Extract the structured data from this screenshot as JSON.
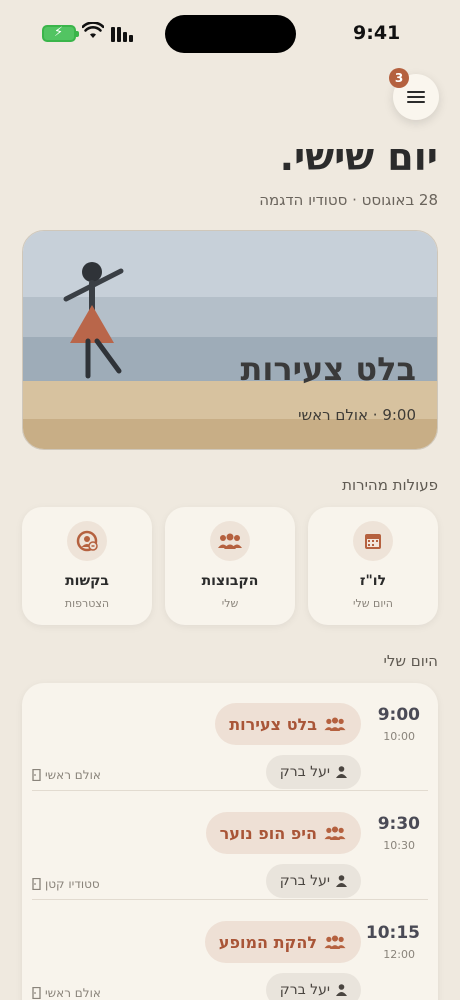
{
  "status": {
    "time": "9:41"
  },
  "menu": {
    "badge_count": "3"
  },
  "header": {
    "title": "יום שישי.",
    "subtitle": "28 באוגוסט · סטודיו הדגמה"
  },
  "hero": {
    "title": "בלט צעירות",
    "meta": "9:00 · אולם ראשי"
  },
  "quick_actions": {
    "label": "פעולות מהירות",
    "items": [
      {
        "title": "לו\"ז",
        "subtitle": "היום שלי",
        "icon": "calendar-icon"
      },
      {
        "title": "הקבוצות",
        "subtitle": "שלי",
        "icon": "group-icon"
      },
      {
        "title": "בקשות",
        "subtitle": "הצטרפות",
        "icon": "user-request-icon"
      }
    ]
  },
  "schedule": {
    "label": "היום שלי",
    "items": [
      {
        "start": "9:00",
        "end": "10:00",
        "class": "בלט צעירות",
        "teacher": "יעל ברק",
        "room": "אולם ראשי"
      },
      {
        "start": "9:30",
        "end": "10:30",
        "class": "היפ הופ נוער",
        "teacher": "יעל ברק",
        "room": "סטודיו קטן"
      },
      {
        "start": "10:15",
        "end": "12:00",
        "class": "להקת המופע",
        "teacher": "יעל ברק",
        "room": "אולם ראשי"
      }
    ]
  },
  "colors": {
    "background": "#efe9df",
    "accent": "#b5613f",
    "card": "#f8f4ec"
  }
}
